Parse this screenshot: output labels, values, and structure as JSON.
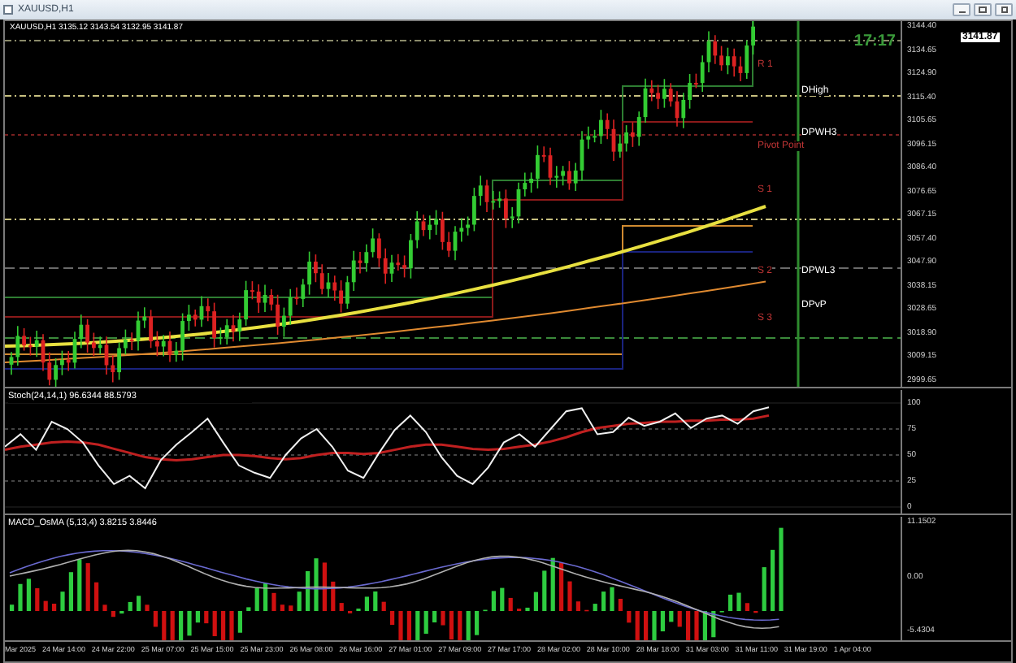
{
  "window": {
    "title": "XAUUSD,H1"
  },
  "chart": {
    "header": "XAUUSD,H1  3135.12 3143.54 3132.95 3141.87",
    "clock": "17:17",
    "current_price": "3141.87",
    "price_axis": [
      "3144.40",
      "3134.65",
      "3124.90",
      "3115.40",
      "3105.65",
      "3096.15",
      "3086.40",
      "3076.65",
      "3067.15",
      "3057.40",
      "3047.90",
      "3038.15",
      "3028.65",
      "3018.90",
      "3009.15",
      "2999.65"
    ],
    "level_labels": [
      {
        "text": "R 1",
        "kind": "pivot"
      },
      {
        "text": "DHigh",
        "kind": "daily"
      },
      {
        "text": "DPWH3",
        "kind": "daily"
      },
      {
        "text": "Pivot Point",
        "kind": "pivot"
      },
      {
        "text": "S 1",
        "kind": "pivot"
      },
      {
        "text": "S 2",
        "kind": "pivot"
      },
      {
        "text": "DPWL3",
        "kind": "daily"
      },
      {
        "text": "DPvP",
        "kind": "daily"
      },
      {
        "text": "S 3",
        "kind": "pivot"
      }
    ]
  },
  "stochastic": {
    "label": "Stoch(24,14,1) 96.6344 88.5793",
    "chart_data": {
      "type": "line",
      "grid": true,
      "ylim": [
        0,
        100
      ],
      "yticks": [
        100,
        75,
        50,
        25,
        0
      ],
      "series": [
        {
          "color": "#f0f0f0",
          "values": [
            58,
            70,
            55,
            82,
            75,
            62,
            40,
            22,
            30,
            18,
            45,
            60,
            72,
            85,
            62,
            40,
            33,
            28,
            50,
            66,
            75,
            58,
            35,
            28,
            52,
            74,
            88,
            72,
            48,
            30,
            22,
            38,
            62,
            70,
            58,
            75,
            92,
            95,
            70,
            72,
            86,
            78,
            82,
            90,
            76,
            85,
            88,
            80,
            92,
            96
          ]
        },
        {
          "color": "#c02020",
          "values": [
            55,
            58,
            60,
            62,
            63,
            62,
            60,
            56,
            52,
            48,
            46,
            45,
            46,
            48,
            50,
            50,
            49,
            47,
            46,
            47,
            50,
            52,
            52,
            51,
            52,
            55,
            58,
            60,
            60,
            58,
            56,
            55,
            56,
            58,
            60,
            63,
            67,
            72,
            76,
            78,
            80,
            81,
            82,
            82,
            83,
            83,
            84,
            84,
            85,
            88
          ]
        }
      ]
    }
  },
  "macd": {
    "label": "MACD_OsMA (5,13,4) 3.8215 3.8446",
    "axis": [
      "11.1502",
      "0.00",
      "-5.4304"
    ]
  },
  "time_axis": [
    "Mar 2025",
    "24 Mar 14:00",
    "24 Mar 22:00",
    "25 Mar 07:00",
    "25 Mar 15:00",
    "25 Mar 23:00",
    "26 Mar 08:00",
    "26 Mar 16:00",
    "27 Mar 01:00",
    "27 Mar 09:00",
    "27 Mar 17:00",
    "28 Mar 02:00",
    "28 Mar 10:00",
    "28 Mar 18:00",
    "31 Mar 03:00",
    "31 Mar 11:00",
    "31 Mar 19:00",
    "1 Apr 04:00"
  ]
}
